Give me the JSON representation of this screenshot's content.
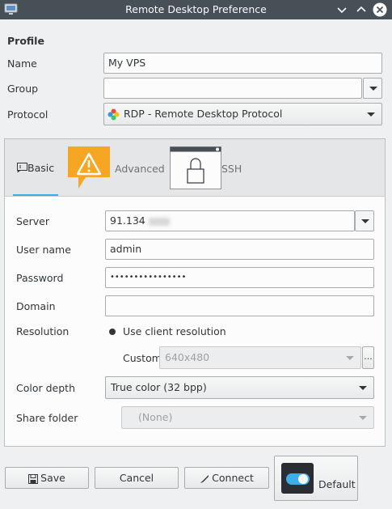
{
  "window": {
    "title": "Remote Desktop Preference",
    "app_icon": "remote-desktop-icon",
    "controls": [
      "minimize-icon",
      "maximize-icon",
      "close-icon"
    ]
  },
  "profile": {
    "section_label": "Profile",
    "name_label": "Name",
    "name_value": "My VPS",
    "group_label": "Group",
    "group_value": "",
    "protocol_label": "Protocol",
    "protocol_value": "RDP - Remote Desktop Protocol",
    "protocol_icon": "rdp-protocol-icon"
  },
  "tabs": [
    {
      "label": "Basic",
      "icon": "basic-tab-icon",
      "active": true
    },
    {
      "label": "Advanced",
      "icon": "warning-icon",
      "active": false
    },
    {
      "label": "SSH",
      "icon": "ssh-lock-icon",
      "active": false
    }
  ],
  "basic": {
    "server_label": "Server",
    "server_value": "91.134",
    "username_label": "User name",
    "username_value": "admin",
    "password_label": "Password",
    "password_value": "••••••••••••••••",
    "domain_label": "Domain",
    "domain_value": "",
    "resolution_label": "Resolution",
    "resolution_option": "Use client resolution",
    "custom_label": "Custom",
    "custom_value": "640x480",
    "custom_more": "...",
    "color_depth_label": "Color depth",
    "color_depth_value": "True color (32 bpp)",
    "share_folder_label": "Share folder",
    "share_folder_value": "(None)"
  },
  "footer": {
    "save_label": "Save",
    "cancel_label": "Cancel",
    "connect_label": "Connect",
    "default_label": "Default"
  },
  "colors": {
    "titlebar": "#475057",
    "accent": "#3daee9",
    "warning": "#f6a623"
  }
}
